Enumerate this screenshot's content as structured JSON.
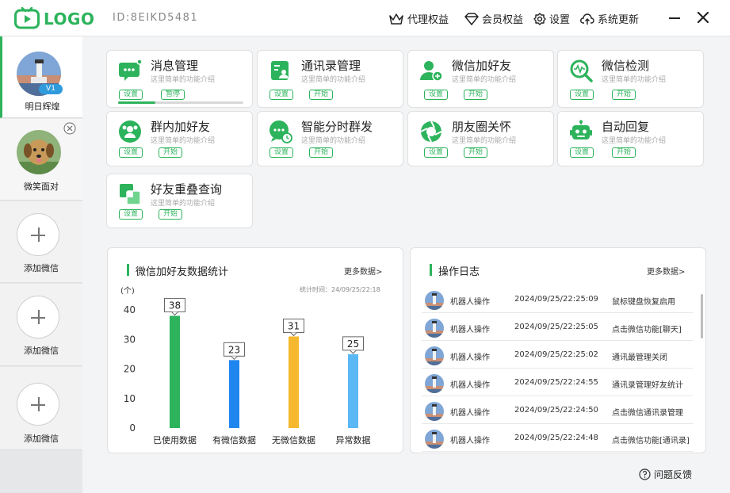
{
  "app": {
    "logo_text": "LOGO",
    "device_id": "ID:8EIKD5481",
    "accent_color": "#2db35c"
  },
  "topnav": [
    {
      "label": "代理权益",
      "icon": "crown-icon"
    },
    {
      "label": "会员权益",
      "icon": "diamond-icon"
    },
    {
      "label": "设置",
      "icon": "gear-icon"
    },
    {
      "label": "系统更新",
      "icon": "cloud-upload-icon"
    }
  ],
  "accounts": [
    {
      "name": "明日辉煌",
      "badge": "V1",
      "active": true
    },
    {
      "name": "微笑面对",
      "active": false
    }
  ],
  "add_slots": [
    {
      "label": "添加微信"
    },
    {
      "label": "添加微信"
    },
    {
      "label": "添加微信"
    }
  ],
  "features": [
    {
      "title": "消息管理",
      "desc": "这里简单的功能介绍",
      "buttons": [
        "设置",
        "暂停"
      ],
      "progress": 0.3,
      "icon": "message-bubble-icon"
    },
    {
      "title": "通讯录管理",
      "desc": "这里简单的功能介绍",
      "buttons": [
        "设置",
        "开始"
      ],
      "icon": "contacts-icon"
    },
    {
      "title": "微信加好友",
      "desc": "这里简单的功能介绍",
      "buttons": [
        "设置",
        "开始"
      ],
      "icon": "add-user-icon"
    },
    {
      "title": "微信检测",
      "desc": "这里简单的功能介绍",
      "buttons": [
        "设置",
        "开始"
      ],
      "icon": "magnifier-pulse-icon"
    },
    {
      "title": "群内加好友",
      "desc": "这里简单的功能介绍",
      "buttons": [
        "设置",
        "开始"
      ],
      "icon": "group-icon"
    },
    {
      "title": "智能分时群发",
      "desc": "这里简单的功能介绍",
      "buttons": [
        "设置",
        "开始"
      ],
      "icon": "scheduled-message-icon"
    },
    {
      "title": "朋友圈关怀",
      "desc": "这里简单的功能介绍",
      "buttons": [
        "设置",
        "开始"
      ],
      "icon": "aperture-icon"
    },
    {
      "title": "自动回复",
      "desc": "这里简单的功能介绍",
      "buttons": [
        "设置",
        "开始"
      ],
      "icon": "robot-icon"
    },
    {
      "title": "好友重叠查询",
      "desc": "这里简单的功能介绍",
      "buttons": [
        "设置",
        "开始"
      ],
      "icon": "overlap-squares-icon"
    }
  ],
  "stats_panel": {
    "title": "微信加好友数据统计",
    "more": "更多数据>",
    "stat_time": "统计时间：24/09/25/22:18"
  },
  "chart_data": {
    "type": "bar",
    "categories": [
      "已使用数据",
      "有微信数据",
      "无微信数据",
      "异常数据"
    ],
    "values": [
      38,
      23,
      31,
      25
    ],
    "colors": [
      "#2db35c",
      "#1f86ef",
      "#f5b82e",
      "#5ab8f5"
    ],
    "ylabel": "(个)",
    "ylim": [
      0,
      40
    ],
    "yticks": [
      0,
      10,
      20,
      30,
      40
    ],
    "grid": false
  },
  "log_panel": {
    "title": "操作日志",
    "more": "更多数据>",
    "entries": [
      {
        "actor": "机器人操作",
        "time": "2024/09/25/22:25:09",
        "message": "鼠标键盘恢复启用"
      },
      {
        "actor": "机器人操作",
        "time": "2024/09/25/22:25:05",
        "message": "点击微信功能[聊天]"
      },
      {
        "actor": "机器人操作",
        "time": "2024/09/25/22:25:02",
        "message": "通讯最管理关闭"
      },
      {
        "actor": "机器人操作",
        "time": "2024/09/25/22:24:55",
        "message": "通讯录管理好友统计"
      },
      {
        "actor": "机器人操作",
        "time": "2024/09/25/22:24:50",
        "message": "点击微信通讯录管理"
      },
      {
        "actor": "机器人操作",
        "time": "2024/09/25/22:24:48",
        "message": "点击微信功能[通讯录]"
      }
    ]
  },
  "footer": {
    "feedback": "问题反馈"
  }
}
